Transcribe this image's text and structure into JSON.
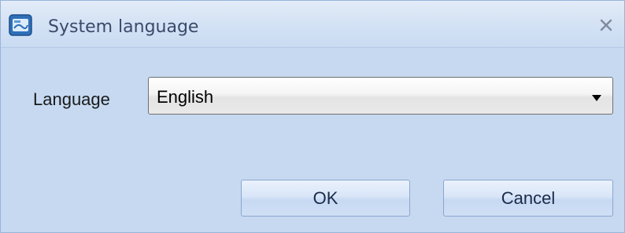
{
  "window": {
    "title": "System language",
    "close_icon": "close-icon",
    "app_icon": "app-icon"
  },
  "form": {
    "language_label": "Language",
    "language_value": "English"
  },
  "buttons": {
    "ok_label": "OK",
    "cancel_label": "Cancel"
  },
  "colors": {
    "dialog_background": "#c6d9f1",
    "titlebar_background": "#d4e2f5",
    "button_border": "#8aa6cf"
  }
}
